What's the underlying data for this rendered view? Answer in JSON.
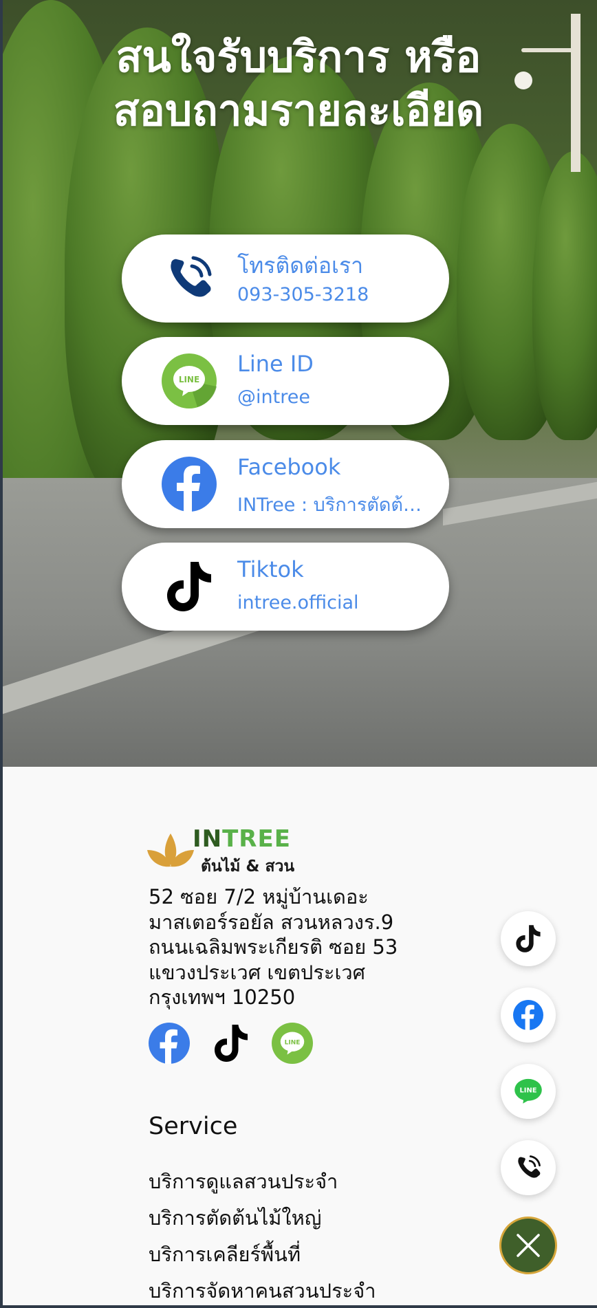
{
  "hero": {
    "title_line1": "สนใจรับบริการ หรือ",
    "title_line2": "สอบถามรายละเอียด"
  },
  "contacts": [
    {
      "icon": "phone-icon",
      "title": "โทรติดต่อเรา",
      "sub": "093-305-3218"
    },
    {
      "icon": "line-icon",
      "title": "Line ID",
      "sub": "@intree"
    },
    {
      "icon": "facebook-icon",
      "title": "Facebook",
      "sub": "INTree : บริการตัดต้นไม้"
    },
    {
      "icon": "tiktok-icon",
      "title": "Tiktok",
      "sub": "intree.official"
    }
  ],
  "brand": {
    "name_in": "IN",
    "name_tree": "TREE",
    "tagline": "ต้นไม้ & สวน"
  },
  "address": {
    "line1": "52 ซอย 7/2 หมู่บ้านเดอะ",
    "line2": "มาสเตอร์รอยัล สวนหลวงร.9",
    "line3": "ถนนเฉลิมพระเกียรติ ซอย 53",
    "line4": "แขวงประเวศ เขตประเวศ",
    "line5": "กรุงเทพฯ 10250"
  },
  "service": {
    "heading": "Service",
    "items": [
      "บริการดูแลสวนประจำ",
      "บริการตัดต้นไม้ใหญ่",
      "บริการเคลียร์พื้นที่",
      "บริการจัดหาคนสวนประจำ"
    ]
  },
  "colors": {
    "link_blue": "#4b8be8",
    "facebook_blue": "#3b7ce8",
    "line_green": "#7bc043",
    "close_green": "#3f5f2a",
    "brand_green": "#59b149",
    "brand_gold": "#d6a63b"
  }
}
